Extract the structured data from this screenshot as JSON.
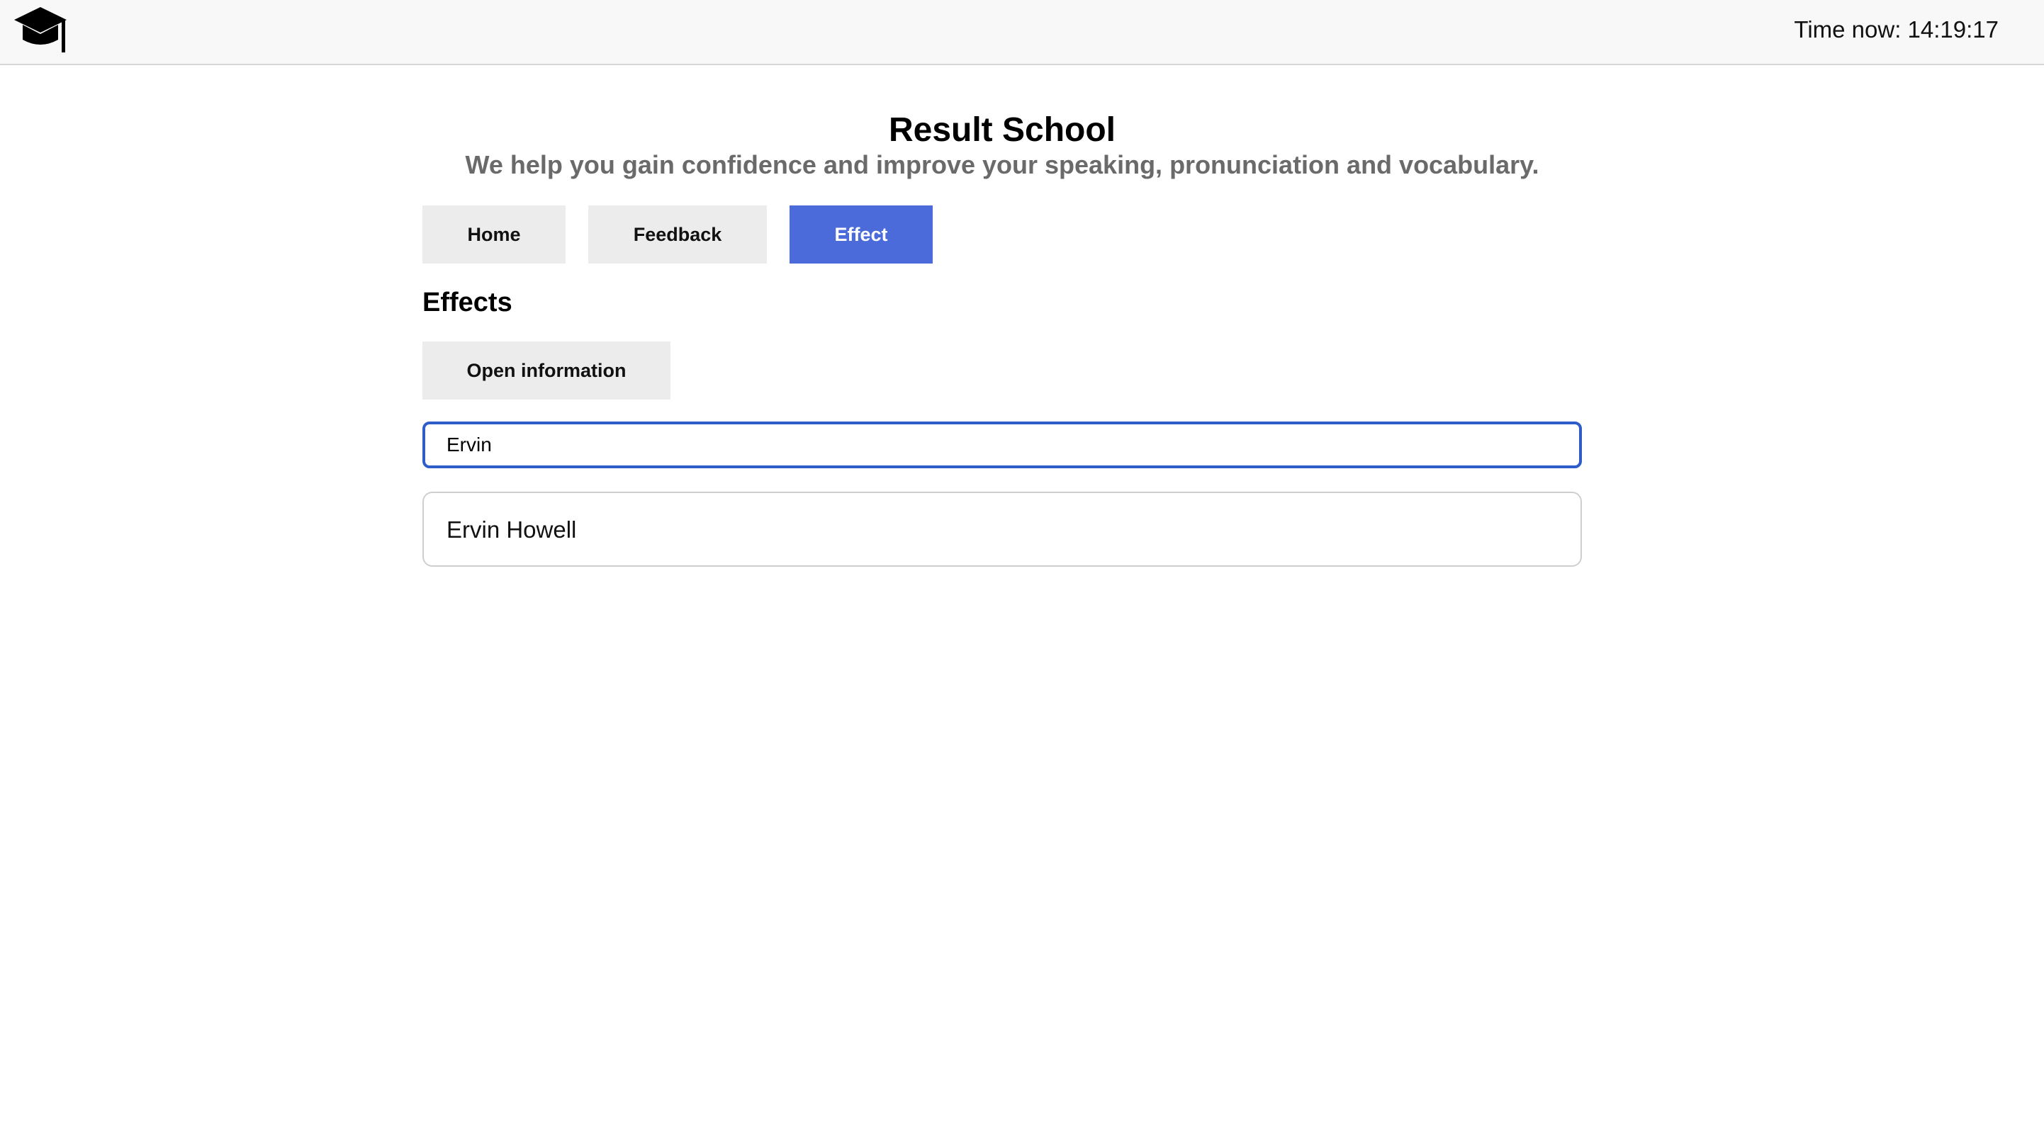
{
  "header": {
    "logo_icon": "graduation-cap-icon",
    "clock_text": "Time now: 14:19:17"
  },
  "main": {
    "title": "Result School",
    "subtitle": "We help you gain confidence and improve your speaking, pronunciation and vocabulary.",
    "nav": {
      "home_label": "Home",
      "feedback_label": "Feedback",
      "effect_label": "Effect",
      "active": "Effect"
    },
    "section_heading": "Effects",
    "open_info_label": "Open information",
    "search": {
      "value": "Ervin"
    },
    "results": [
      {
        "name": "Ervin Howell"
      }
    ]
  },
  "colors": {
    "active_nav": "#4a6bd9",
    "input_focus_border": "#2e5cc9",
    "button_bg": "#ececec",
    "subtitle_text": "#6a6a6a"
  }
}
